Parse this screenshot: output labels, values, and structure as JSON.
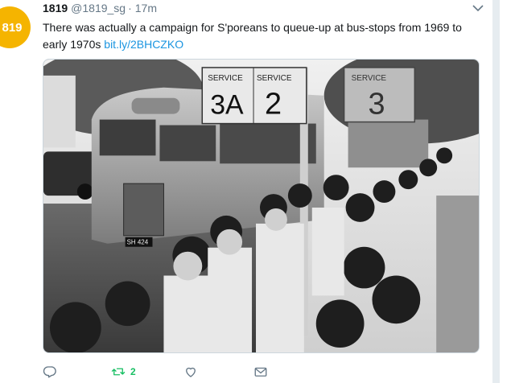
{
  "tweet": {
    "avatar_text": "819",
    "display_name": "1819",
    "handle": "@1819_sg",
    "separator": "·",
    "time": "17m",
    "text": "There was actually a campaign for S'poreans to queue-up at bus-stops from 1969 to early 1970s",
    "link": "bit.ly/2BHCZKO",
    "retweet_count": "2"
  },
  "photo": {
    "signs": [
      "SERVICE",
      "3A",
      "SERVICE",
      "2",
      "SERVICE",
      "3"
    ],
    "plate": "SH 424"
  },
  "icons": {
    "reply": "reply-icon",
    "retweet": "retweet-icon",
    "like": "heart-icon",
    "message": "envelope-icon",
    "caret": "chevron-down-icon"
  },
  "colors": {
    "avatar": "#f5b400",
    "link": "#1b95e0",
    "retweet": "#17bf63",
    "muted": "#657786"
  }
}
